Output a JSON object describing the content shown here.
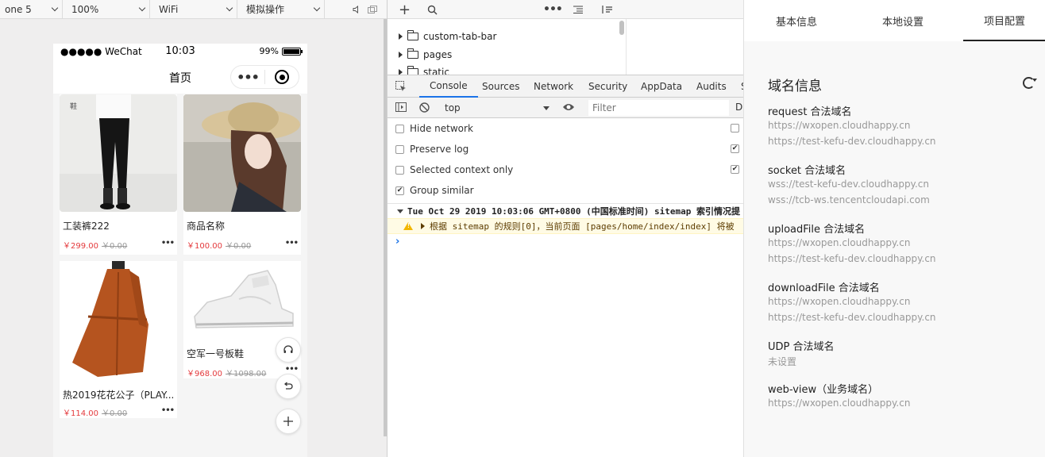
{
  "simulator": {
    "toolbar": {
      "device": "one 5",
      "zoom": "100%",
      "network": "WiFi",
      "operation": "模拟操作"
    },
    "phone": {
      "status": {
        "signal": "●●●●● WeChat",
        "time": "10:03",
        "battery": "99%",
        "battery_level": 0.99
      },
      "nav_title": "首页",
      "capsule_more": "•••",
      "products": [
        {
          "name": "工装裤222",
          "price": "￥299.00",
          "original_price": "￥0.00",
          "more": "•••",
          "image": "black-pants-photo"
        },
        {
          "name": "商品名称",
          "price": "￥100.00",
          "original_price": "￥0.00",
          "more": "•••",
          "image": "woman-hat-photo"
        },
        {
          "name": "热2019花花公子（PLAY...",
          "price": "￥114.00",
          "original_price": "￥0.00",
          "more": "•••",
          "image": "orange-coat-photo"
        },
        {
          "name": "空军一号板鞋",
          "price": "￥968.00",
          "original_price": "￥1098.00",
          "more": "•••",
          "image": "white-sneaker-photo"
        }
      ],
      "float_buttons": [
        "headset-icon",
        "undo-icon",
        "plus-icon"
      ]
    }
  },
  "devtools": {
    "file_tree": [
      "custom-tab-bar",
      "pages",
      "static"
    ],
    "tabs": [
      "Console",
      "Sources",
      "Network",
      "Security",
      "AppData",
      "Audits",
      "S"
    ],
    "active_tab": "Console",
    "context": "top",
    "filter_placeholder": "Filter",
    "levels_hint": "D",
    "options": [
      {
        "label": "Hide network",
        "checked": false
      },
      {
        "label": "Preserve log",
        "checked": false
      },
      {
        "label": "Selected context only",
        "checked": false
      },
      {
        "label": "Group similar",
        "checked": true
      }
    ],
    "options_right": [
      false,
      true,
      true
    ],
    "log_group": "Tue Oct 29 2019 10:03:06 GMT+0800 (中国标准时间) sitemap 索引情况提",
    "log_warning": "根据 sitemap 的规则[0]，当前页面 [pages/home/index/index] 将被",
    "prompt": "›"
  },
  "project": {
    "tabs": [
      "基本信息",
      "本地设置",
      "项目配置"
    ],
    "active_tab": "项目配置",
    "title": "域名信息",
    "sections": [
      {
        "label": "request 合法域名",
        "values": [
          "https://wxopen.cloudhappy.cn",
          "https://test-kefu-dev.cloudhappy.cn"
        ]
      },
      {
        "label": "socket 合法域名",
        "values": [
          "wss://test-kefu-dev.cloudhappy.cn",
          "wss://tcb-ws.tencentcloudapi.com"
        ]
      },
      {
        "label": "uploadFile 合法域名",
        "values": [
          "https://wxopen.cloudhappy.cn",
          "https://test-kefu-dev.cloudhappy.cn"
        ]
      },
      {
        "label": "downloadFile 合法域名",
        "values": [
          "https://wxopen.cloudhappy.cn",
          "https://test-kefu-dev.cloudhappy.cn"
        ]
      },
      {
        "label": "UDP 合法域名",
        "values": [
          "未设置"
        ]
      },
      {
        "label": "web-view（业务域名）",
        "values": [
          "https://wxopen.cloudhappy.cn"
        ]
      }
    ]
  },
  "colors": {
    "price_red": "#e4393c",
    "devtools_active": "#1a73e8",
    "warning_bg": "#fffbe5"
  }
}
